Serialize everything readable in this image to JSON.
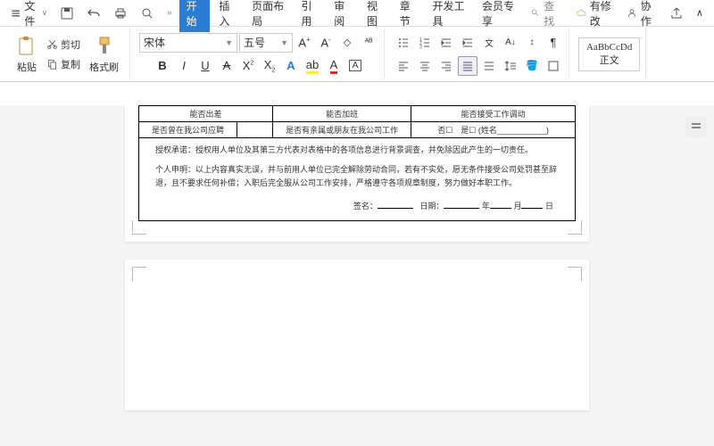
{
  "titlebar": {
    "menu_label": "文件",
    "has_changes": "有修改",
    "collab": "协作"
  },
  "tabs": [
    "开始",
    "插入",
    "页面布局",
    "引用",
    "审阅",
    "视图",
    "章节",
    "开发工具",
    "会员专享"
  ],
  "search_placeholder": "查找",
  "ribbon": {
    "paste": "粘贴",
    "cut": "剪切",
    "copy": "复制",
    "format_painter": "格式刷",
    "font_name": "宋体",
    "font_size": "五号",
    "style_preview": "AaBbCcDd",
    "style_name": "正文"
  },
  "doc": {
    "row1": {
      "c1": "能否出差",
      "c2": "能否加班",
      "c3": "能否接受工作调动"
    },
    "row2": {
      "c1": "是否曾在我公司应聘",
      "c2": "是否有亲属或朋友在我公司工作",
      "c3": "否☐　是☐ (姓名___________)"
    },
    "decl1": "授权承诺：授权用人单位及其第三方代表对表格中的各项信息进行背景调查，并免除因此产生的一切责任。",
    "decl2": "个人申明：以上内容真实无误，并与前用人单位已完全解除劳动合同，若有不实处，愿无条件接受公司处罚甚至辞退，且不要求任何补偿；入职后完全服从公司工作安排，严格遵守各项规章制度，努力做好本职工作。",
    "sig_label": "签名：",
    "date_label": "日期：",
    "year": "年",
    "month": "月",
    "day": "日"
  }
}
